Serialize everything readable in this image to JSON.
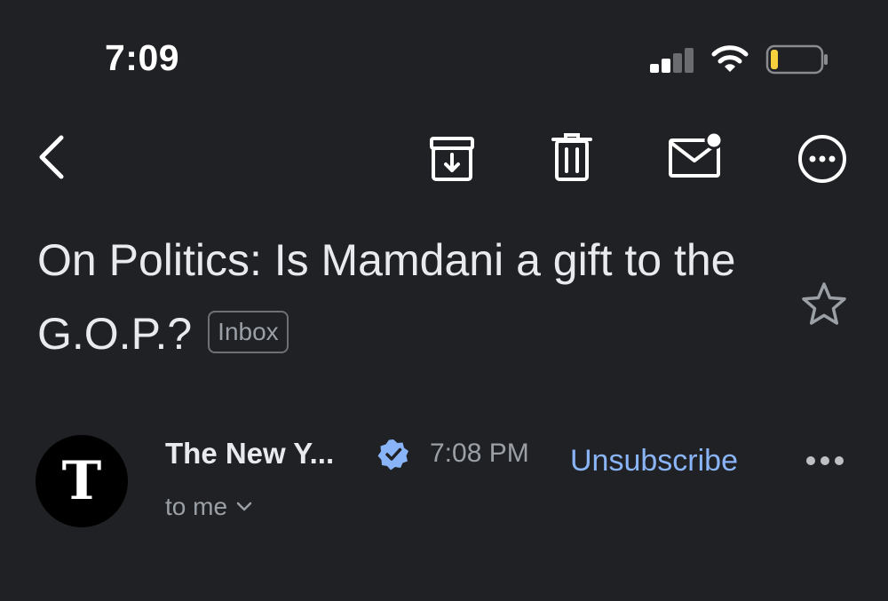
{
  "status_bar": {
    "time": "7:09",
    "signal_bars_active": 2,
    "signal_bars_total": 4,
    "battery_level": 0.15,
    "battery_color": "#f4d03f"
  },
  "toolbar": {
    "back_icon": "chevron-left-icon",
    "archive_icon": "archive-icon",
    "delete_icon": "trash-icon",
    "mark_unread_icon": "mail-unread-icon",
    "more_icon": "more-horizontal-circle-icon"
  },
  "email": {
    "subject": "On Politics: Is Mamdani a gift to the G.O.P.?",
    "label": "Inbox",
    "sender": "The New Y...",
    "sent_time": "7:08 PM",
    "unsubscribe_label": "Unsubscribe",
    "recipient": "to me",
    "avatar_glyph": "T"
  },
  "colors": {
    "background": "#202124",
    "accent_link": "#8ab4f8",
    "verified_badge": "#8ab4f8"
  }
}
